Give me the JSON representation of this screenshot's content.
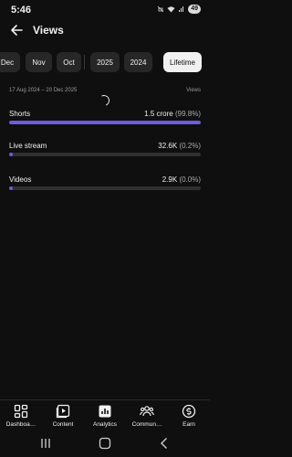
{
  "status_bar": {
    "time": "5:46",
    "battery": "49"
  },
  "header": {
    "title": "Views"
  },
  "periods": [
    {
      "label": "Dec",
      "active": false
    },
    {
      "label": "Nov",
      "active": false
    },
    {
      "label": "Oct",
      "active": false
    },
    {
      "label": "2025",
      "active": false
    },
    {
      "label": "2024",
      "active": false
    },
    {
      "label": "Lifetime",
      "active": true
    }
  ],
  "range": {
    "dates": "17 Aug 2024 – 20 Dec 2025",
    "metric": "Views"
  },
  "metrics": [
    {
      "name": "Shorts",
      "value": "1.5 crore",
      "percent": "(99.8%)",
      "share": 99.8
    },
    {
      "name": "Live stream",
      "value": "32.6K",
      "percent": "(0.2%)",
      "share": 0.2
    },
    {
      "name": "Videos",
      "value": "2.9K",
      "percent": "(0.0%)",
      "share": 0.0
    }
  ],
  "bottom_nav": [
    {
      "label": "Dashboa…",
      "icon": "dashboard-icon",
      "active": false
    },
    {
      "label": "Content",
      "icon": "content-icon",
      "active": false
    },
    {
      "label": "Analytics",
      "icon": "analytics-icon",
      "active": true
    },
    {
      "label": "Commun…",
      "icon": "community-icon",
      "active": false
    },
    {
      "label": "Earn",
      "icon": "earn-icon",
      "active": false
    }
  ],
  "colors": {
    "accent": "#6a5de0",
    "background": "#0f0f0f",
    "chip": "#272727",
    "chip_active": "#f1f1f1"
  }
}
